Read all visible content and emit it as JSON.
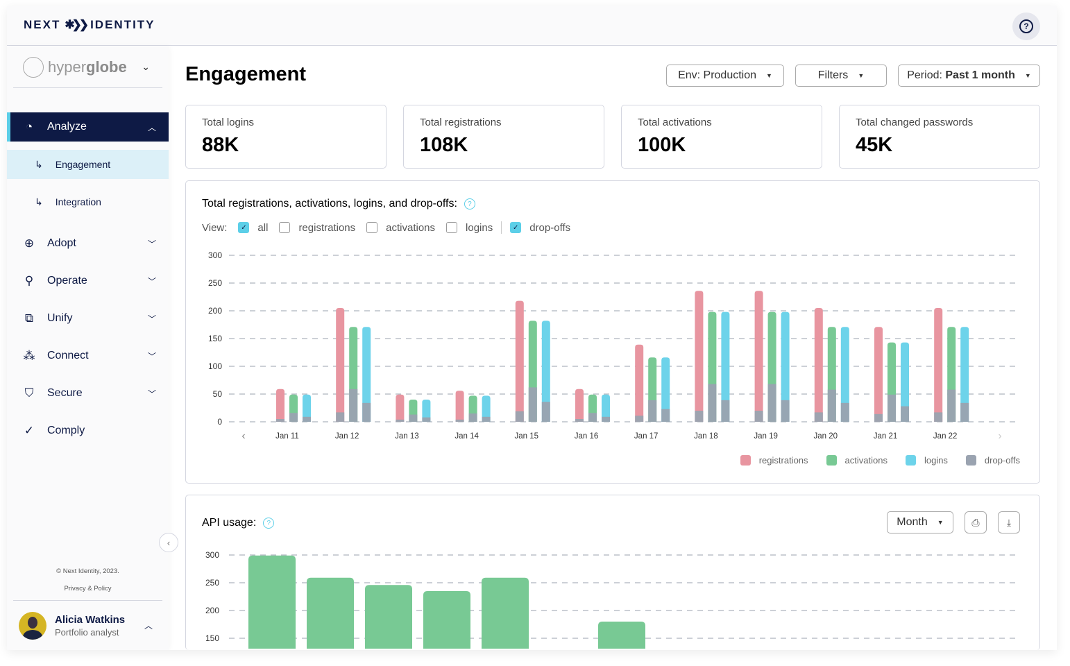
{
  "header": {
    "logo_left": "NEXT",
    "logo_right": "IDENTITY"
  },
  "sidebar": {
    "brand_light": "hyper",
    "brand_bold": "globe",
    "items": [
      {
        "label": "Analyze",
        "icon": "pie-chart-icon",
        "active": true,
        "subitems": [
          {
            "label": "Engagement",
            "selected": true
          },
          {
            "label": "Integration"
          }
        ]
      },
      {
        "label": "Adopt",
        "icon": "adopt-icon"
      },
      {
        "label": "Operate",
        "icon": "sliders-icon"
      },
      {
        "label": "Unify",
        "icon": "layers-icon"
      },
      {
        "label": "Connect",
        "icon": "network-icon"
      },
      {
        "label": "Secure",
        "icon": "shield-icon"
      },
      {
        "label": "Comply",
        "icon": "check-circle-icon"
      }
    ],
    "copyright": "© Next Identity, 2023.",
    "privacy": "Privacy & Policy",
    "user": {
      "name": "Alicia Watkins",
      "role": "Portfolio analyst"
    }
  },
  "main": {
    "title": "Engagement",
    "env": "Env: Production",
    "filters": "Filters",
    "period_prefix": "Period: ",
    "period_value": "Past 1 month",
    "cards": [
      {
        "label": "Total logins",
        "value": "88K"
      },
      {
        "label": "Total registrations",
        "value": "108K"
      },
      {
        "label": "Total activations",
        "value": "100K"
      },
      {
        "label": "Total changed passwords",
        "value": "45K"
      }
    ],
    "engagement_chart": {
      "title": "Total registrations, activations, logins, and drop-offs:",
      "view_label": "View:",
      "view_options": [
        {
          "label": "all",
          "checked": true
        },
        {
          "label": "registrations",
          "checked": false
        },
        {
          "label": "activations",
          "checked": false
        },
        {
          "label": "logins",
          "checked": false
        },
        {
          "label": "drop-offs",
          "checked": true
        }
      ]
    },
    "api_chart": {
      "title": "API usage:",
      "period": "Month"
    }
  },
  "chart_data": [
    {
      "type": "bar",
      "title": "Total registrations, activations, logins, and drop-offs:",
      "categories": [
        "Jan 11",
        "Jan 12",
        "Jan 13",
        "Jan 14",
        "Jan 15",
        "Jan 16",
        "Jan 17",
        "Jan 18",
        "Jan 19",
        "Jan 20",
        "Jan 21",
        "Jan 22"
      ],
      "ylim": [
        0,
        300
      ],
      "yticks": [
        "0",
        "50",
        "100",
        "150",
        "200",
        "250",
        "300"
      ],
      "grid": true,
      "legend": "bottom-right",
      "series": [
        {
          "name": "registrations",
          "color": "#e895a0",
          "values": [
            59,
            205,
            49,
            56,
            218,
            59,
            139,
            236,
            236,
            205,
            171,
            205
          ],
          "drop_offs": [
            5,
            17,
            4,
            4,
            19,
            5,
            11,
            20,
            20,
            17,
            14,
            17
          ]
        },
        {
          "name": "activations",
          "color": "#78c994",
          "values": [
            49,
            171,
            40,
            47,
            182,
            49,
            116,
            198,
            198,
            171,
            143,
            171
          ],
          "drop_offs": [
            16,
            59,
            13,
            15,
            62,
            16,
            39,
            68,
            68,
            58,
            49,
            58
          ]
        },
        {
          "name": "logins",
          "color": "#6dd3ea",
          "values": [
            49,
            171,
            40,
            47,
            182,
            49,
            116,
            198,
            198,
            171,
            143,
            171
          ],
          "drop_offs": [
            9,
            34,
            8,
            9,
            36,
            9,
            23,
            39,
            39,
            34,
            28,
            34
          ]
        },
        {
          "name": "drop-offs",
          "color": "#9aa3b0"
        }
      ]
    },
    {
      "type": "bar",
      "title": "API usage:",
      "yticks": [
        "150",
        "200",
        "250",
        "300"
      ],
      "ylim_visible": [
        150,
        300
      ],
      "grid": true,
      "color": "#78c994",
      "values": [
        299,
        259,
        246,
        235,
        259,
        null,
        180
      ]
    }
  ]
}
